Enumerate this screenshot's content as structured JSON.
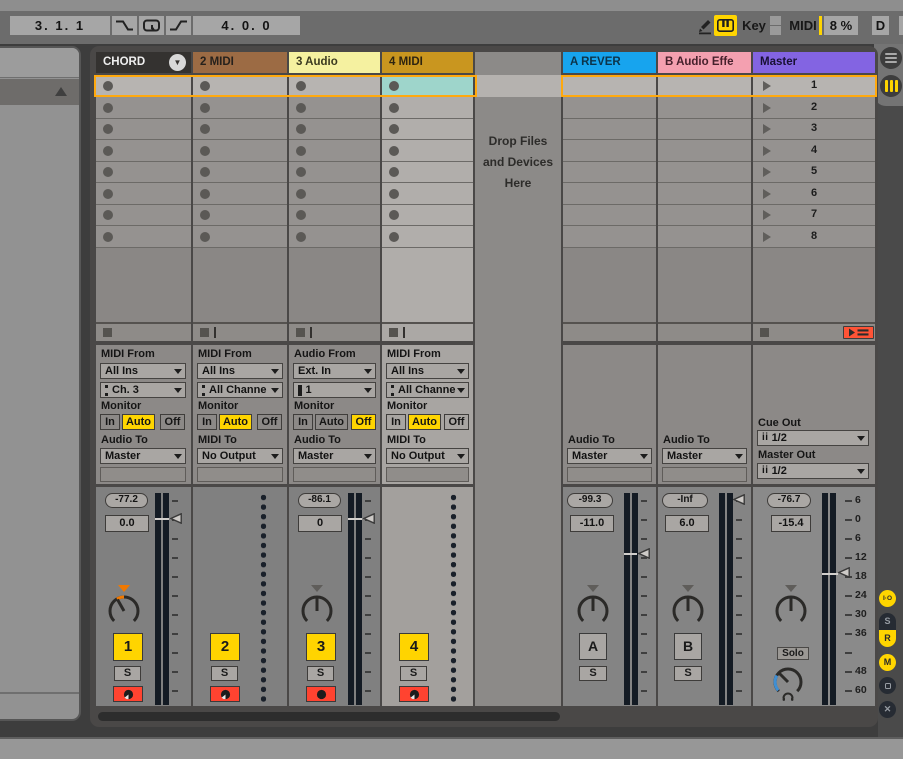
{
  "transport": {
    "position": "3. 1. 1",
    "loop_length": "4. 0. 0",
    "key_label": "Key",
    "midi_label": "MIDI",
    "cpu_load": "8 %",
    "disk_overload": "D"
  },
  "tracks": [
    {
      "name": "CHORD",
      "io": {
        "from_label": "MIDI From",
        "input": "All Ins",
        "channel": "Ch. 3",
        "monitor_label": "Monitor",
        "monitor_in": "In",
        "monitor_auto": "Auto",
        "monitor_off": "Off",
        "monitor_active": "Auto",
        "to_label": "Audio To",
        "output": "Master"
      },
      "mixer": {
        "peak": "-77.2",
        "volume": "0.0",
        "number": "1",
        "solo": "S"
      }
    },
    {
      "name": "2 MIDI",
      "io": {
        "from_label": "MIDI From",
        "input": "All Ins",
        "channel": "All Channe",
        "monitor_label": "Monitor",
        "monitor_in": "In",
        "monitor_auto": "Auto",
        "monitor_off": "Off",
        "monitor_active": "Auto",
        "to_label": "MIDI To",
        "output": "No Output"
      },
      "mixer": {
        "number": "2",
        "solo": "S"
      }
    },
    {
      "name": "3 Audio",
      "io": {
        "from_label": "Audio From",
        "input": "Ext. In",
        "channel": "1",
        "monitor_label": "Monitor",
        "monitor_in": "In",
        "monitor_auto": "Auto",
        "monitor_off": "Off",
        "monitor_active": "Off",
        "to_label": "Audio To",
        "output": "Master"
      },
      "mixer": {
        "peak": "-86.1",
        "volume": "0",
        "number": "3",
        "solo": "S"
      }
    },
    {
      "name": "4 MIDI",
      "io": {
        "from_label": "MIDI From",
        "input": "All Ins",
        "channel": "All Channe",
        "monitor_label": "Monitor",
        "monitor_in": "In",
        "monitor_auto": "Auto",
        "monitor_off": "Off",
        "monitor_active": "Auto",
        "to_label": "MIDI To",
        "output": "No Output"
      },
      "mixer": {
        "number": "4",
        "solo": "S"
      }
    }
  ],
  "returns": [
    {
      "name": "A REVER",
      "to_label": "Audio To",
      "output": "Master",
      "mixer": {
        "peak": "-99.3",
        "volume": "-11.0",
        "letter": "A",
        "solo": "S"
      }
    },
    {
      "name": "B Audio Effe",
      "to_label": "Audio To",
      "output": "Master",
      "mixer": {
        "peak": "-Inf",
        "volume": "6.0",
        "letter": "B",
        "solo": "S"
      }
    }
  ],
  "master": {
    "name": "Master",
    "cue_label": "Cue Out",
    "cue_value": "1/2",
    "out_label": "Master Out",
    "out_value": "1/2",
    "mixer": {
      "peak": "-76.7",
      "volume": "-15.4",
      "solo": "Solo"
    },
    "scenes": [
      "1",
      "2",
      "3",
      "4",
      "5",
      "6",
      "7",
      "8"
    ],
    "db_scale": [
      "6",
      "0",
      "6",
      "12",
      "18",
      "24",
      "30",
      "36",
      "48",
      "60"
    ]
  },
  "drop_zone": {
    "line1": "Drop Files",
    "line2": "and Devices",
    "line3": "Here"
  },
  "colors": {
    "selection_orange": "#ffa90e",
    "button_yellow": "#ffd500",
    "arm_red": "#ff4330",
    "clip_teal": "#9ed5cb",
    "track2_header": "#9c6b44",
    "track3_header": "#f5f1a0",
    "track4_header": "#c9961f",
    "return_a_header": "#17a4ee",
    "return_b_header": "#f4a0b0",
    "master_header": "#8364e2"
  }
}
